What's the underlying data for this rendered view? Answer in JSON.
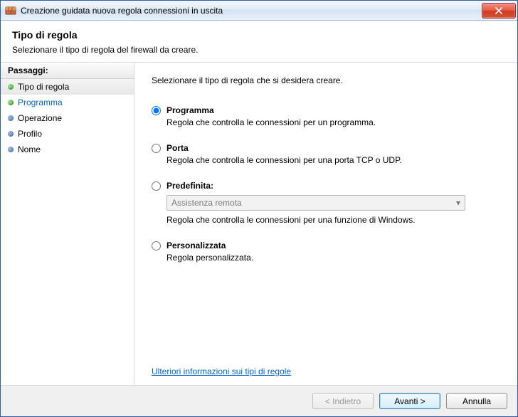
{
  "window": {
    "title": "Creazione guidata nuova regola connessioni in uscita"
  },
  "header": {
    "title": "Tipo di regola",
    "subtitle": "Selezionare il tipo di regola del firewall da creare."
  },
  "sidebar": {
    "steps_label": "Passaggi:",
    "steps": [
      {
        "label": "Tipo di regola"
      },
      {
        "label": "Programma"
      },
      {
        "label": "Operazione"
      },
      {
        "label": "Profilo"
      },
      {
        "label": "Nome"
      }
    ]
  },
  "content": {
    "prompt": "Selezionare il tipo di regola che si desidera creare.",
    "options": [
      {
        "name": "Programma",
        "desc": "Regola che controlla le connessioni per un programma."
      },
      {
        "name": "Porta",
        "desc": "Regola che controlla le connessioni per una porta TCP o UDP."
      },
      {
        "name": "Predefinita:",
        "desc": "Regola che controlla le connessioni per una funzione di Windows.",
        "dropdown_value": "Assistenza remota"
      },
      {
        "name": "Personalizzata",
        "desc": "Regola personalizzata."
      }
    ],
    "learn_more": "Ulteriori informazioni sui tipi di regole"
  },
  "footer": {
    "back": "< Indietro",
    "next": "Avanti >",
    "cancel": "Annulla"
  }
}
